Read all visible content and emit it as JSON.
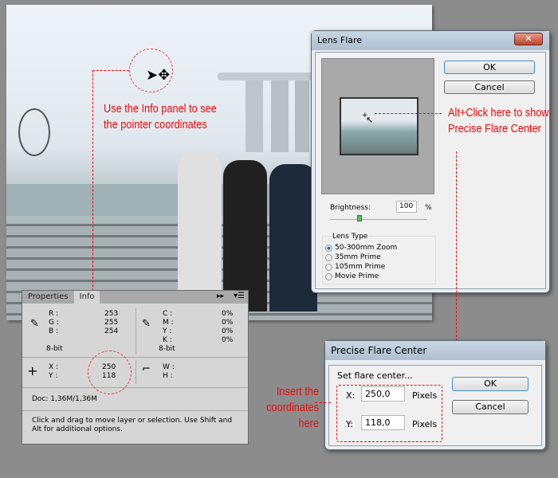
{
  "annotations": {
    "info_hint": "Use the Info panel to see the pointer coordinates",
    "alt_click": "Alt+Click here to show Precise Flare Center",
    "insert": "Insert the coordinates here"
  },
  "info_panel": {
    "tabs": [
      "Properties",
      "Info"
    ],
    "active_tab": "Info",
    "rgb": {
      "labels": [
        "R :",
        "G :",
        "B :"
      ],
      "values": [
        "253",
        "255",
        "254"
      ],
      "bit": "8-bit"
    },
    "cmyk": {
      "labels": [
        "C :",
        "M :",
        "Y :",
        "K :"
      ],
      "values": [
        "0%",
        "0%",
        "0%",
        "0%"
      ],
      "bit": "8-bit"
    },
    "xy": {
      "labels": [
        "X :",
        "Y :"
      ],
      "values": [
        "250",
        "118"
      ]
    },
    "wh": {
      "labels": [
        "W :",
        "H :"
      ]
    },
    "doc": "Doc: 1,36M/1,36M",
    "hint": "Click and drag to move layer or selection.  Use Shift and Alt for additional options."
  },
  "lens_flare": {
    "title": "Lens Flare",
    "ok": "OK",
    "cancel": "Cancel",
    "brightness_label": "Brightness:",
    "brightness_value": "100",
    "percent": "%",
    "brightness_fraction": 0.3,
    "lens_type_label": "Lens Type",
    "lens_types": [
      "50-300mm Zoom",
      "35mm Prime",
      "105mm Prime",
      "Movie Prime"
    ],
    "selected": "50-300mm Zoom"
  },
  "precise": {
    "title": "Precise Flare Center",
    "set_label": "Set flare center...",
    "x_label": "X:",
    "x_value": "250,0",
    "y_label": "Y:",
    "y_value": "118,0",
    "unit": "Pixels",
    "ok": "OK",
    "cancel": "Cancel"
  },
  "colors": {
    "annotation": "#f00a0a"
  }
}
